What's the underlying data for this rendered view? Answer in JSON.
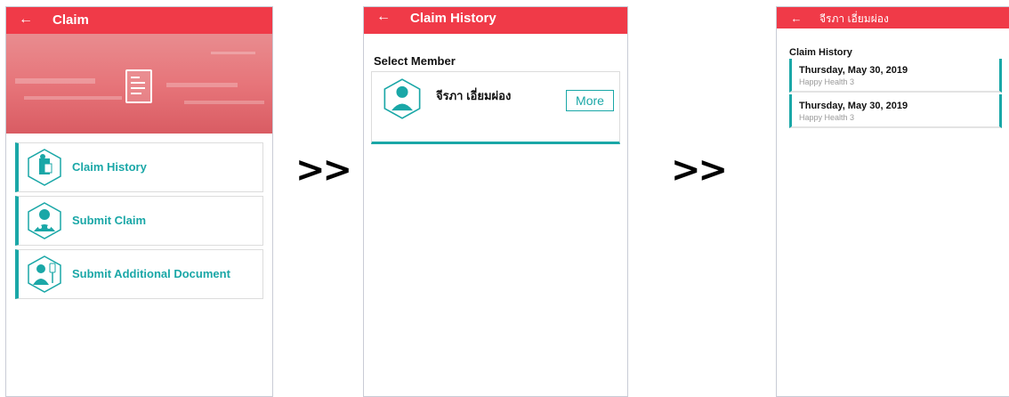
{
  "screen1": {
    "title": "Claim",
    "back_icon": "arrow-left-icon",
    "menu": [
      {
        "label": "Claim History",
        "icon": "patient-document-icon"
      },
      {
        "label": "Submit Claim",
        "icon": "doctor-icon"
      },
      {
        "label": "Submit Additional Document",
        "icon": "patient-iv-icon"
      }
    ]
  },
  "separator": ">>",
  "screen2": {
    "title": "Claim History",
    "select_member_label": "Select Member",
    "member": {
      "name": "จีรภา เอี่ยมผ่อง",
      "more_label": "More",
      "avatar_icon": "person-avatar-icon"
    }
  },
  "screen3": {
    "title": "จีรภา เอี่ยมผ่อง",
    "section_title": "Claim History",
    "items": [
      {
        "date": "Thursday, May 30, 2019",
        "plan": "Happy Health 3"
      },
      {
        "date": "Thursday, May 30, 2019",
        "plan": "Happy Health 3"
      }
    ]
  },
  "colors": {
    "header_red": "#f03a48",
    "accent_teal": "#1aa7a7"
  }
}
